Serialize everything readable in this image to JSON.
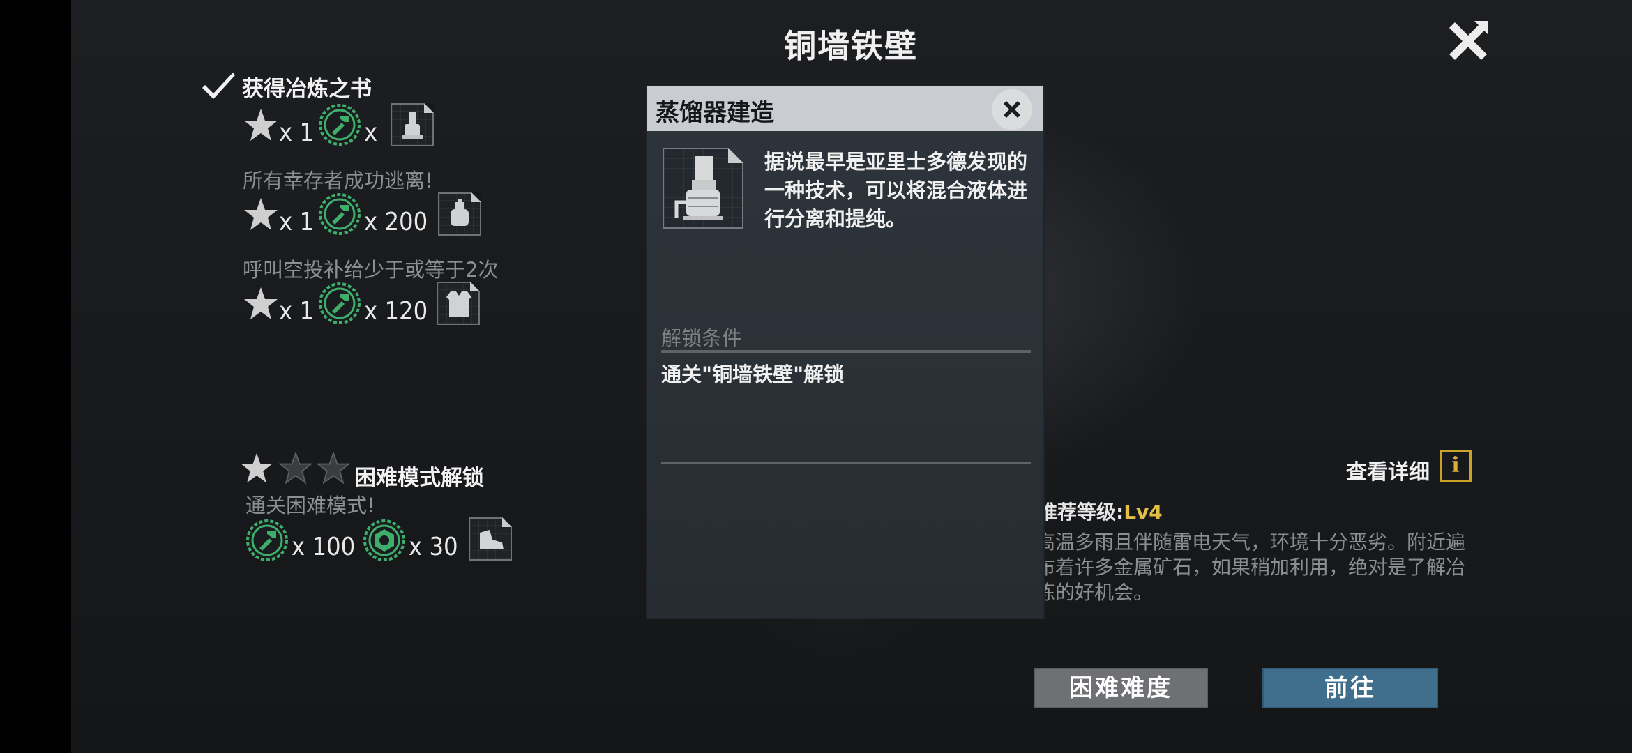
{
  "header": {
    "title": "铜墙铁壁"
  },
  "tasks": [
    {
      "title": "获得冶炼之书",
      "rewards": {
        "stars": "x 1",
        "parts": "x"
      }
    },
    {
      "subtitle": "所有幸存者成功逃离!",
      "rewards": {
        "stars": "x 1",
        "parts": "x 200"
      }
    },
    {
      "subtitle": "呼叫空投补给少于或等于2次",
      "rewards": {
        "stars": "x 1",
        "parts": "x 120"
      }
    }
  ],
  "hard_mode": {
    "title": "困难模式解锁",
    "subtitle": "通关困难模式!",
    "reward_parts": "x 100",
    "reward_nuts": "x 30"
  },
  "level_info": {
    "view_detail": "查看详细",
    "info_icon": "i",
    "recommended_label": "推荐等级:",
    "recommended_value": "Lv4",
    "description": "高温多雨且伴随雷电天气，环境十分恶劣。附近遍布着许多金属矿石，如果稍加利用，绝对是了解冶炼的好机会。"
  },
  "buttons": {
    "hard": "困难难度",
    "go": "前往"
  },
  "popup": {
    "title": "蒸馏器建造",
    "description": "据说最早是亚里士多德发现的一种技术，可以将混合液体进行分离和提纯。",
    "unlock_label": "解锁条件",
    "unlock_text": "通关\"铜墙铁壁\"解锁"
  },
  "colors": {
    "accent_green": "#3fae6b",
    "level_yellow": "#e2c048",
    "go_button": "#3f6f8d",
    "hard_button": "#6f7073"
  },
  "icons": [
    "check-icon",
    "star-icon",
    "gear-part-icon",
    "nut-icon",
    "distiller-icon",
    "vest-icon",
    "boot-icon",
    "close-icon",
    "info-icon"
  ]
}
